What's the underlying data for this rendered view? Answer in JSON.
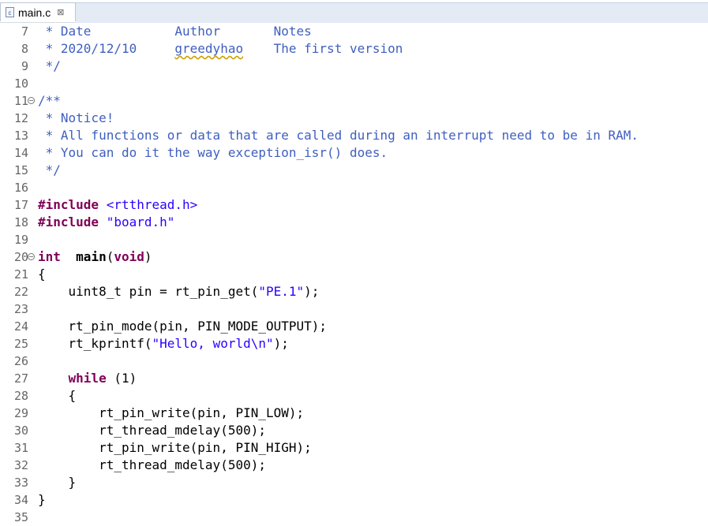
{
  "tab": {
    "title": "main.c",
    "close_glyph": "⊠",
    "icon": "c-file-icon"
  },
  "lines": [
    {
      "n": "7",
      "fold": "",
      "seg": [
        [
          "cmt",
          " * Date           Author       Notes"
        ]
      ]
    },
    {
      "n": "8",
      "fold": "",
      "seg": [
        [
          "cmt",
          " * 2020/12/10     "
        ],
        [
          "cmt squig",
          "greedyhao"
        ],
        [
          "cmt",
          "    The first version"
        ]
      ]
    },
    {
      "n": "9",
      "fold": "",
      "seg": [
        [
          "cmt",
          " */"
        ]
      ]
    },
    {
      "n": "10",
      "fold": "",
      "seg": []
    },
    {
      "n": "11",
      "fold": "⊖",
      "seg": [
        [
          "cmt",
          "/**"
        ]
      ]
    },
    {
      "n": "12",
      "fold": "",
      "seg": [
        [
          "cmt",
          " * Notice!"
        ]
      ]
    },
    {
      "n": "13",
      "fold": "",
      "seg": [
        [
          "cmt",
          " * All functions or data that are called during an interrupt need to be in RAM."
        ]
      ]
    },
    {
      "n": "14",
      "fold": "",
      "seg": [
        [
          "cmt",
          " * You can do it the way exception_isr() does."
        ]
      ]
    },
    {
      "n": "15",
      "fold": "",
      "seg": [
        [
          "cmt",
          " */"
        ]
      ]
    },
    {
      "n": "16",
      "fold": "",
      "seg": []
    },
    {
      "n": "17",
      "fold": "",
      "seg": [
        [
          "kw",
          "#include"
        ],
        [
          "str",
          " <rtthread.h>"
        ]
      ]
    },
    {
      "n": "18",
      "fold": "",
      "seg": [
        [
          "kw",
          "#include"
        ],
        [
          "str",
          " \"board.h\""
        ]
      ]
    },
    {
      "n": "19",
      "fold": "",
      "seg": []
    },
    {
      "n": "20",
      "fold": "⊖",
      "seg": [
        [
          "kw",
          "int"
        ],
        [
          "",
          "  "
        ],
        [
          "b",
          "main"
        ],
        [
          "",
          "("
        ],
        [
          "kw",
          "void"
        ],
        [
          "",
          ")"
        ]
      ]
    },
    {
      "n": "21",
      "fold": "",
      "seg": [
        [
          "",
          "{"
        ]
      ]
    },
    {
      "n": "22",
      "fold": "",
      "seg": [
        [
          "",
          "    uint8_t pin = rt_pin_get("
        ],
        [
          "str",
          "\"PE.1\""
        ],
        [
          "",
          ");"
        ]
      ]
    },
    {
      "n": "23",
      "fold": "",
      "seg": []
    },
    {
      "n": "24",
      "fold": "",
      "seg": [
        [
          "",
          "    rt_pin_mode(pin, PIN_MODE_OUTPUT);"
        ]
      ]
    },
    {
      "n": "25",
      "fold": "",
      "seg": [
        [
          "",
          "    rt_kprintf("
        ],
        [
          "str",
          "\"Hello, world\\n\""
        ],
        [
          "",
          ");"
        ]
      ]
    },
    {
      "n": "26",
      "fold": "",
      "seg": []
    },
    {
      "n": "27",
      "fold": "",
      "seg": [
        [
          "",
          "    "
        ],
        [
          "kw",
          "while"
        ],
        [
          "",
          " (1)"
        ]
      ]
    },
    {
      "n": "28",
      "fold": "",
      "seg": [
        [
          "",
          "    {"
        ]
      ]
    },
    {
      "n": "29",
      "fold": "",
      "seg": [
        [
          "",
          "        rt_pin_write(pin, PIN_LOW);"
        ]
      ]
    },
    {
      "n": "30",
      "fold": "",
      "seg": [
        [
          "",
          "        rt_thread_mdelay(500);"
        ]
      ]
    },
    {
      "n": "31",
      "fold": "",
      "seg": [
        [
          "",
          "        rt_pin_write(pin, PIN_HIGH);"
        ]
      ]
    },
    {
      "n": "32",
      "fold": "",
      "seg": [
        [
          "",
          "        rt_thread_mdelay(500);"
        ]
      ]
    },
    {
      "n": "33",
      "fold": "",
      "seg": [
        [
          "",
          "    }"
        ]
      ]
    },
    {
      "n": "34",
      "fold": "",
      "seg": [
        [
          "",
          "}"
        ]
      ]
    },
    {
      "n": "35",
      "fold": "",
      "seg": []
    }
  ]
}
